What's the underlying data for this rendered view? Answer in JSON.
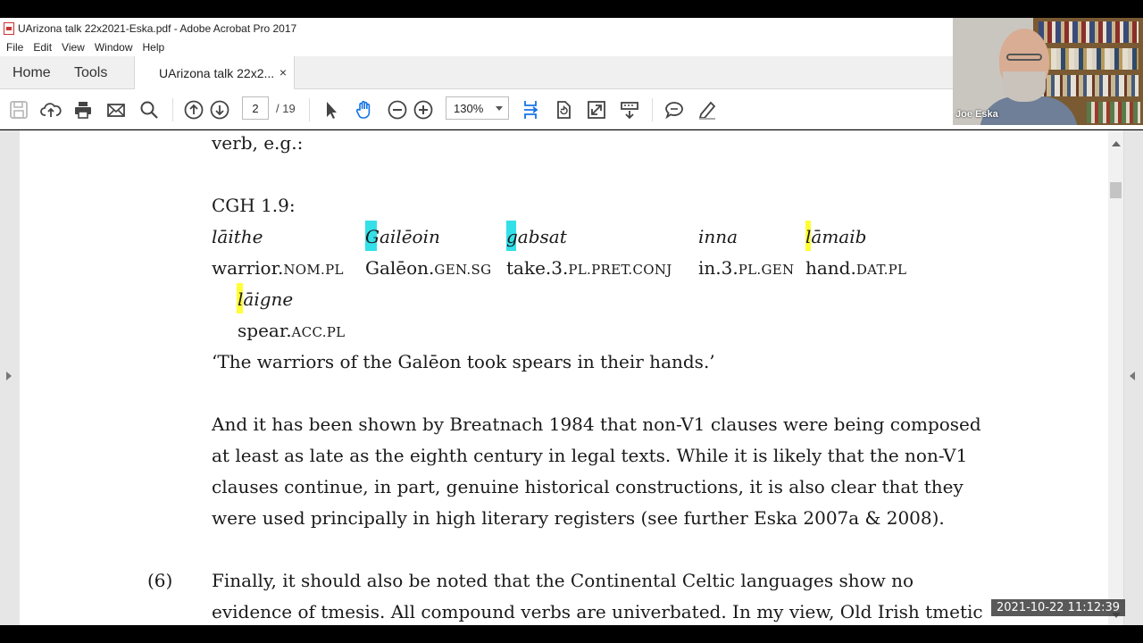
{
  "window": {
    "title": "UArizona talk 22x2021-Eska.pdf - Adobe Acrobat Pro 2017"
  },
  "menu": [
    "File",
    "Edit",
    "View",
    "Window",
    "Help"
  ],
  "tabs": {
    "home": "Home",
    "tools": "Tools",
    "document": "UArizona talk 22x2...",
    "close": "×"
  },
  "toolbar": {
    "page_current": "2",
    "page_total": "/ 19",
    "zoom": "130%"
  },
  "document": {
    "line_verb": "verb, e.g.:",
    "example_label": "CGH 1.9:",
    "gloss_words": [
      {
        "word": "lāithe",
        "gloss_stem": "warrior.",
        "gloss_tags": "NOM.PL"
      },
      {
        "word": "Gailēoin",
        "gloss_stem": "Galēon.",
        "gloss_tags": "GEN.SG"
      },
      {
        "word": "gabsat",
        "gloss_stem": "take.3.",
        "gloss_tags": "PL.PRET.CONJ"
      },
      {
        "word": "inna",
        "gloss_stem": "in.3.",
        "gloss_tags": "PL.GEN"
      },
      {
        "word": "lāmaib",
        "gloss_stem": "hand.",
        "gloss_tags": "DAT.PL"
      },
      {
        "word": "lāigne",
        "gloss_stem": "spear.",
        "gloss_tags": "ACC.PL"
      }
    ],
    "translation": "‘The warriors of the Galēon took spears in their hands.’",
    "paragraph_lines": [
      "And it has been shown by Breatnach 1984 that non-V1 clauses were being composed",
      "at least as late as the eighth century in legal texts.  While it is likely that the non-V1",
      "clauses continue, in part, genuine historical constructions, it is also clear that they",
      "were used principally in high literary registers (see further Eska 2007a & 2008)."
    ],
    "item_number": "(6)",
    "item_lines": [
      "Finally, it should also be noted that the Continental Celtic languages show no",
      "evidence of tmesis.  All compound verbs are univerbated.  In my view, Old Irish tmetic"
    ]
  },
  "webcam": {
    "name": "Joe Eska"
  },
  "timestamp": "2021-10-22  11:12:39",
  "colors": {
    "highlight_cyan": "#33e0e8",
    "highlight_yellow": "#ffff33",
    "accent_blue": "#1473e6"
  }
}
